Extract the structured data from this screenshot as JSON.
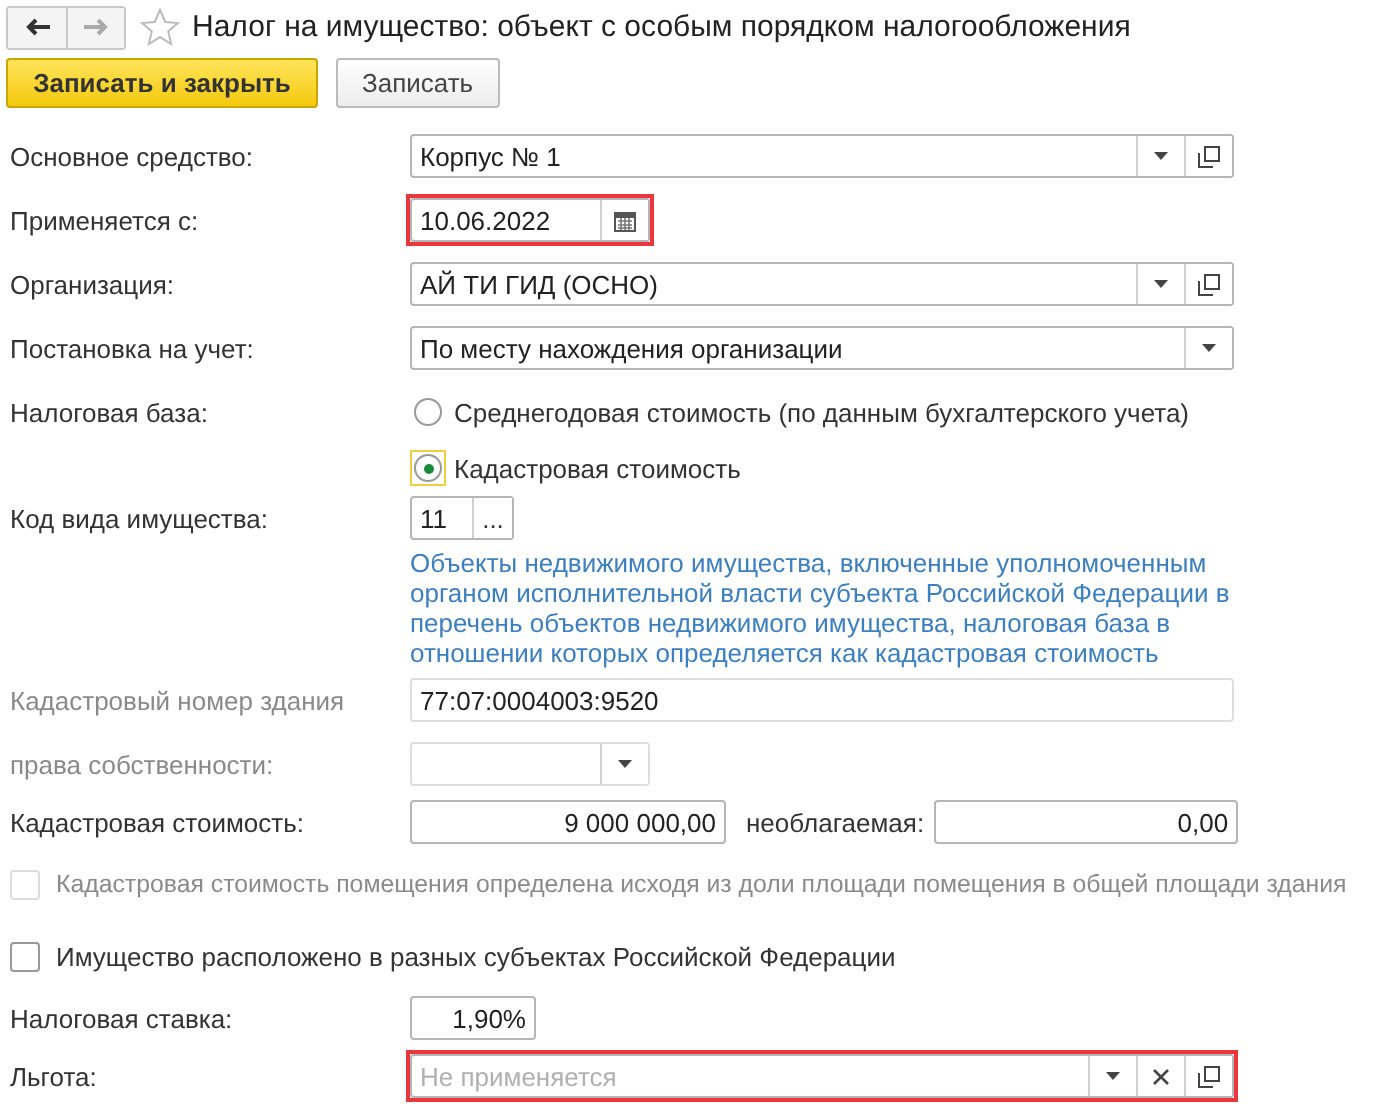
{
  "window": {
    "title": "Налог на имущество: объект с особым порядком налогообложения",
    "favorite": false
  },
  "nav": [
    {
      "kind": "back",
      "disabled": false
    },
    {
      "kind": "forward",
      "disabled": true
    }
  ],
  "toolbar": [
    {
      "label": "Записать и закрыть",
      "primary": true
    },
    {
      "label": "Записать",
      "primary": false
    }
  ],
  "form": [
    {
      "kind": "select",
      "label": "Основное средство:",
      "value": "Корпус № 1",
      "highlighted": false,
      "openable": true
    },
    {
      "kind": "date",
      "label": "Применяется с:",
      "value": "10.06.2022",
      "highlighted": true
    },
    {
      "kind": "select",
      "label": "Организация:",
      "value": "АЙ ТИ ГИД (ОСНО)",
      "highlighted": false,
      "openable": true
    },
    {
      "kind": "select",
      "label": "Постановка на учет:",
      "value": "По месту нахождения организации",
      "highlighted": false
    },
    {
      "kind": "radio",
      "label": "Налоговая база:",
      "options": [
        {
          "label": "Среднегодовая стоимость (по данным бухгалтерского учета)",
          "selected": false
        },
        {
          "label": "Кадастровая стоимость",
          "selected": true
        }
      ]
    },
    {
      "kind": "code",
      "label": "Код вида имущества:",
      "value": "11",
      "button": "...",
      "note": "Объекты недвижимого имущества, включенные уполномоченным органом исполнительной власти субъекта Российской Федерации в перечень объектов недвижимого имущества, налоговая база в отношении которых определяется как кадастровая стоимость"
    },
    {
      "kind": "text",
      "label": "Кадастровый номер здания",
      "value": "77:07:0004003:9520",
      "faded": true
    },
    {
      "kind": "short",
      "label": "права собственности:",
      "faded": true
    },
    {
      "kind": "money",
      "label": "Кадастровая стоимость:",
      "value": "9 000 000,00",
      "extra_label": "необлагаемая:",
      "extra_value": "0,00"
    },
    {
      "kind": "checkbox",
      "label": "Кадастровая стоимость помещения определена исходя из доли площади помещения в общей площади здания",
      "checked": false,
      "faded": true
    },
    {
      "kind": "checkbox",
      "label": "Имущество расположено в разных субъектах Российской Федерации",
      "checked": false,
      "faded": false
    },
    {
      "kind": "percent",
      "label": "Налоговая ставка:",
      "value": "1,90%"
    },
    {
      "kind": "select",
      "label": "Льгота:",
      "placeholder": "Не применяется",
      "highlighted": true,
      "openable": true,
      "clearable": true
    }
  ]
}
